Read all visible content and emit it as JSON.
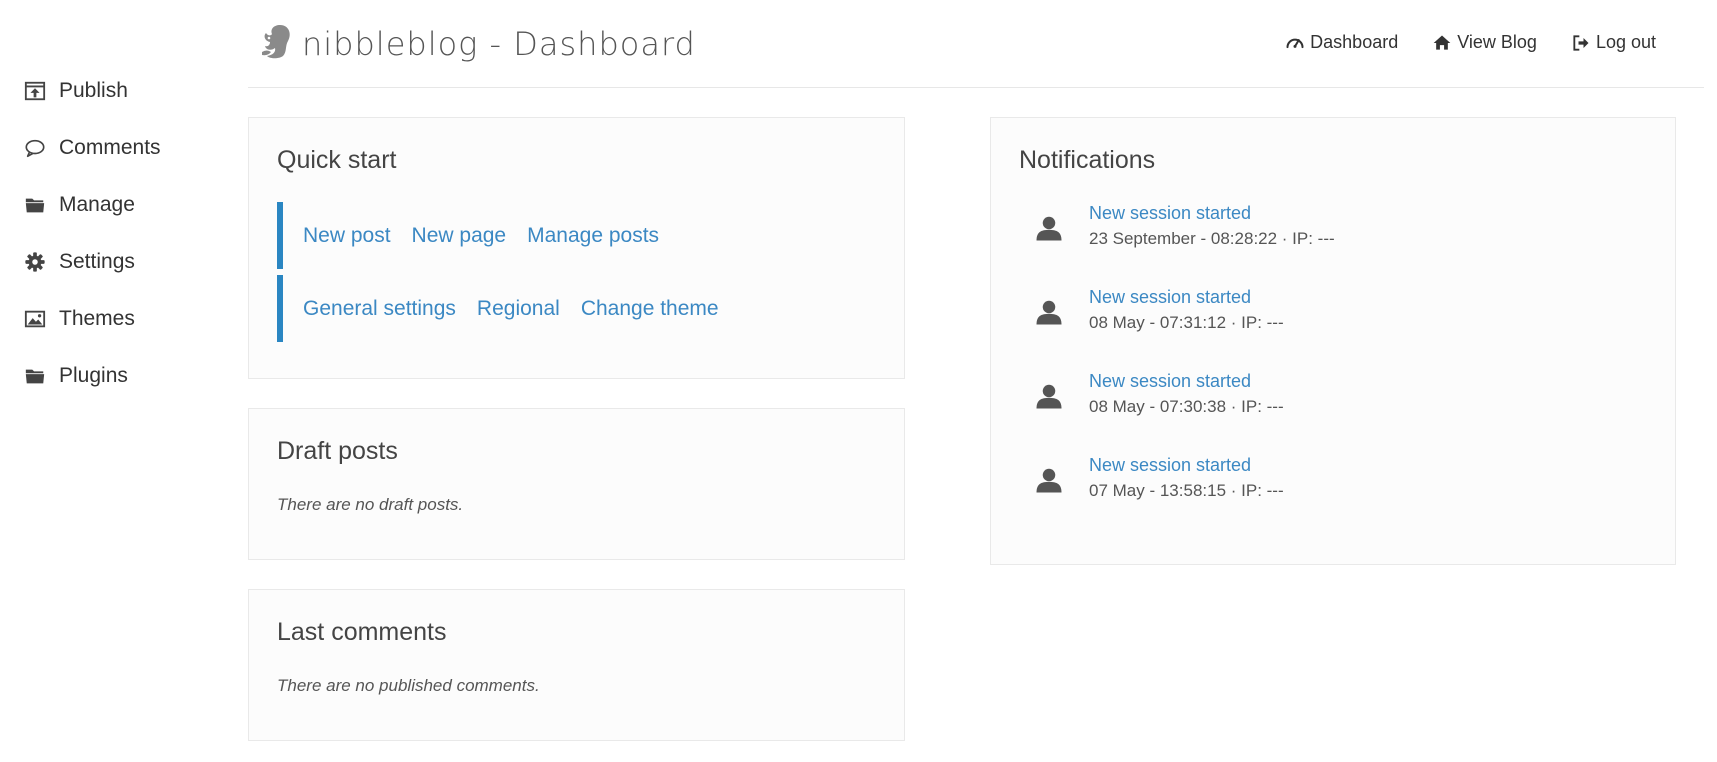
{
  "sidebar": {
    "items": [
      {
        "label": "Publish",
        "icon": "publish-icon"
      },
      {
        "label": "Comments",
        "icon": "comment-icon"
      },
      {
        "label": "Manage",
        "icon": "folder-icon"
      },
      {
        "label": "Settings",
        "icon": "gear-icon"
      },
      {
        "label": "Themes",
        "icon": "image-icon"
      },
      {
        "label": "Plugins",
        "icon": "folder-icon"
      }
    ]
  },
  "header": {
    "title": "nibbleblog - Dashboard",
    "logo_icon": "squirrel-logo-icon",
    "nav": [
      {
        "label": "Dashboard",
        "icon": "dashboard-gauge-icon"
      },
      {
        "label": "View Blog",
        "icon": "home-icon"
      },
      {
        "label": "Log out",
        "icon": "logout-icon"
      }
    ]
  },
  "quick_start": {
    "title": "Quick start",
    "row1": [
      "New post",
      "New page",
      "Manage posts"
    ],
    "row2": [
      "General settings",
      "Regional",
      "Change theme"
    ]
  },
  "draft_posts": {
    "title": "Draft posts",
    "empty": "There are no draft posts."
  },
  "last_comments": {
    "title": "Last comments",
    "empty": "There are no published comments."
  },
  "notifications": {
    "title": "Notifications",
    "items": [
      {
        "text": "New session started",
        "meta": "23 September - 08:28:22 · IP: ---"
      },
      {
        "text": "New session started",
        "meta": "08 May - 07:31:12 · IP: ---"
      },
      {
        "text": "New session started",
        "meta": "08 May - 07:30:38 · IP: ---"
      },
      {
        "text": "New session started",
        "meta": "07 May - 13:58:15 · IP: ---"
      }
    ]
  },
  "colors": {
    "accent": "#2a86c2",
    "link": "#3b88c3",
    "text": "#333333",
    "icon": "#555555"
  }
}
